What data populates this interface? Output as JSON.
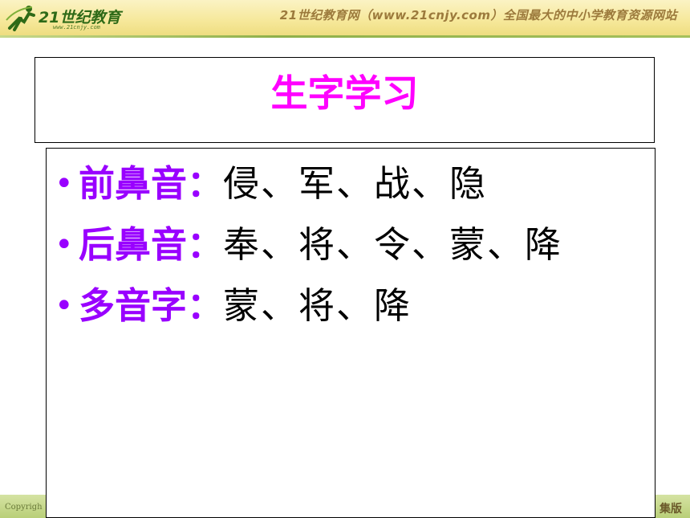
{
  "header": {
    "logo_text": "21世纪教育",
    "logo_sub": "www.21cnjy.com",
    "banner": "21世纪教育网（www.21cnjy.com）全国最大的中小学教育资源网站"
  },
  "title": "生字学习",
  "bullets": [
    {
      "label": "前鼻音：",
      "chars": "侵、军、战、隐"
    },
    {
      "label": "后鼻音：",
      "chars": "奉、将、令、蒙、降"
    },
    {
      "label": "多音字：",
      "chars": "蒙、将、降"
    }
  ],
  "footer": {
    "copyright": "Copyrigh",
    "right_text": "集版"
  },
  "colors": {
    "title": "#ff00ff",
    "label": "#9900ff",
    "chars": "#000000"
  }
}
